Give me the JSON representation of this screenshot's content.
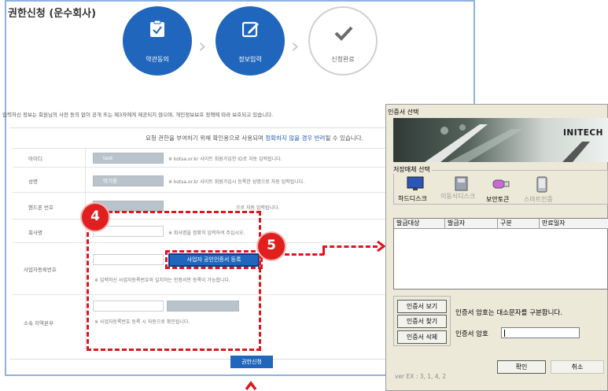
{
  "web": {
    "title": "권한신청 (운수회사)",
    "steps": [
      {
        "label": "약관동의",
        "icon": "clipboard-check-icon"
      },
      {
        "label": "정보입력",
        "icon": "edit-icon"
      },
      {
        "label": "신청완료",
        "icon": "checkmark-icon"
      }
    ],
    "notice": "입력하신 정보는 회원님의 사전 동의 없이 공개 또는 제3자에게 제공되지 않으며, 개인정보보호 정책에 따라 보호되고 있습니다.",
    "form_header": {
      "part1": "요청 권한을 부여하기 위해 확인용으로 사용되며 ",
      "emphasis": "정확하지 않을 경우 반려",
      "part2": "될 수 있습니다."
    },
    "fields": {
      "id": {
        "label": "아이디",
        "value": "test",
        "hint": "※ kotsa.or.kr 사이트 회원가입한 ID로 자동 입력됩니다."
      },
      "name": {
        "label": "성명",
        "value": "박기환",
        "hint": "※ kotsa.or.kr 사이트 회원가입시 등록한 성명으로 자동 입력됩니다."
      },
      "phone": {
        "label": "핸드폰 번호",
        "hint": "으로 자동 입력됩니다."
      },
      "company": {
        "label": "회사명",
        "hint": "※ 회사명을 정확히 입력하여 주십시오."
      },
      "business_no": {
        "label": "사업자등록번호",
        "hint": "※ 입력하신 사업자등록번호와 일치하는 인증서만 등록이 가능합니다."
      },
      "region": {
        "label": "소속 지역본부",
        "hint": "※ 사업자등록번호 등록 시 자동으로 확인됩니다."
      }
    },
    "cert_button": "사업자 공인인증서 등록",
    "submit_button": "권한신청",
    "annotations": {
      "step4": "4",
      "step5": "5"
    }
  },
  "dialog": {
    "title": "인증서 선택",
    "brand": "INITECH",
    "storage_group_label": "저장매체 선택",
    "media": [
      {
        "label": "하드디스크",
        "icon": "monitor-icon",
        "enabled": true
      },
      {
        "label": "이동식디스크",
        "icon": "removable-disk-icon",
        "enabled": false
      },
      {
        "label": "보안토큰",
        "icon": "usb-token-icon",
        "enabled": true
      },
      {
        "label": "스마트인증",
        "icon": "smartphone-icon",
        "enabled": false
      }
    ],
    "columns": [
      "발급대상",
      "발급자",
      "구분",
      "만료일자"
    ],
    "buttons": {
      "view": "인증서 보기",
      "find": "인증서 찾기",
      "delete": "인증서 삭제",
      "ok": "확인",
      "cancel": "취소"
    },
    "case_notice": "인증서 암호는 대소문자를 구분합니다.",
    "password_label": "인증서 암호",
    "version": "ver EX : 3, 1, 4, 2"
  }
}
